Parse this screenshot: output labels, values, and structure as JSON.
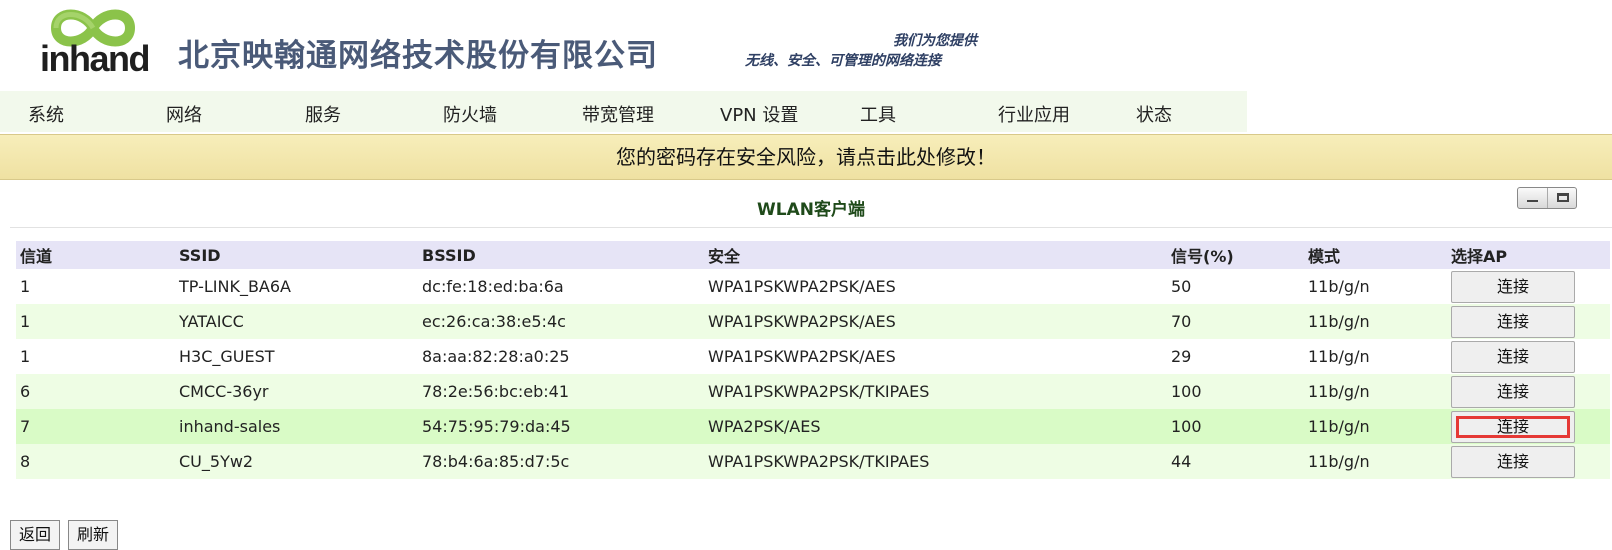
{
  "header": {
    "logo_text": "inhand",
    "company_name": "北京映翰通网络技术股份有限公司",
    "slogan_line1": "我们为您提供",
    "slogan_line2": "无线、安全、可管理的网络连接",
    "logo_color": "#8bc34a"
  },
  "menu": {
    "items": [
      "系统",
      "网络",
      "服务",
      "防火墙",
      "带宽管理",
      "VPN 设置",
      "工具",
      "行业应用",
      "状态"
    ]
  },
  "warning": {
    "text": "您的密码存在安全风险，请点击此处修改！"
  },
  "panel": {
    "title": "WLAN客户端"
  },
  "table": {
    "headers": [
      "信道",
      "SSID",
      "BSSID",
      "安全",
      "信号(%)",
      "模式",
      "选择AP"
    ],
    "connect_label": "连接",
    "rows": [
      {
        "channel": "1",
        "ssid": "TP-LINK_BA6A",
        "bssid": "dc:fe:18:ed:ba:6a",
        "security": "WPA1PSKWPA2PSK/AES",
        "signal": "50",
        "mode": "11b/g/n"
      },
      {
        "channel": "1",
        "ssid": "YATAICC",
        "bssid": "ec:26:ca:38:e5:4c",
        "security": "WPA1PSKWPA2PSK/AES",
        "signal": "70",
        "mode": "11b/g/n"
      },
      {
        "channel": "1",
        "ssid": "H3C_GUEST",
        "bssid": "8a:aa:82:28:a0:25",
        "security": "WPA1PSKWPA2PSK/AES",
        "signal": "29",
        "mode": "11b/g/n"
      },
      {
        "channel": "6",
        "ssid": "CMCC-36yr",
        "bssid": "78:2e:56:bc:eb:41",
        "security": "WPA1PSKWPA2PSK/TKIPAES",
        "signal": "100",
        "mode": "11b/g/n"
      },
      {
        "channel": "7",
        "ssid": "inhand-sales",
        "bssid": "54:75:95:79:da:45",
        "security": "WPA2PSK/AES",
        "signal": "100",
        "mode": "11b/g/n"
      },
      {
        "channel": "8",
        "ssid": "CU_5Yw2",
        "bssid": "78:b4:6a:85:d7:5c",
        "security": "WPA1PSKWPA2PSK/TKIPAES",
        "signal": "44",
        "mode": "11b/g/n"
      }
    ]
  },
  "footer": {
    "back_label": "返回",
    "refresh_label": "刷新"
  }
}
